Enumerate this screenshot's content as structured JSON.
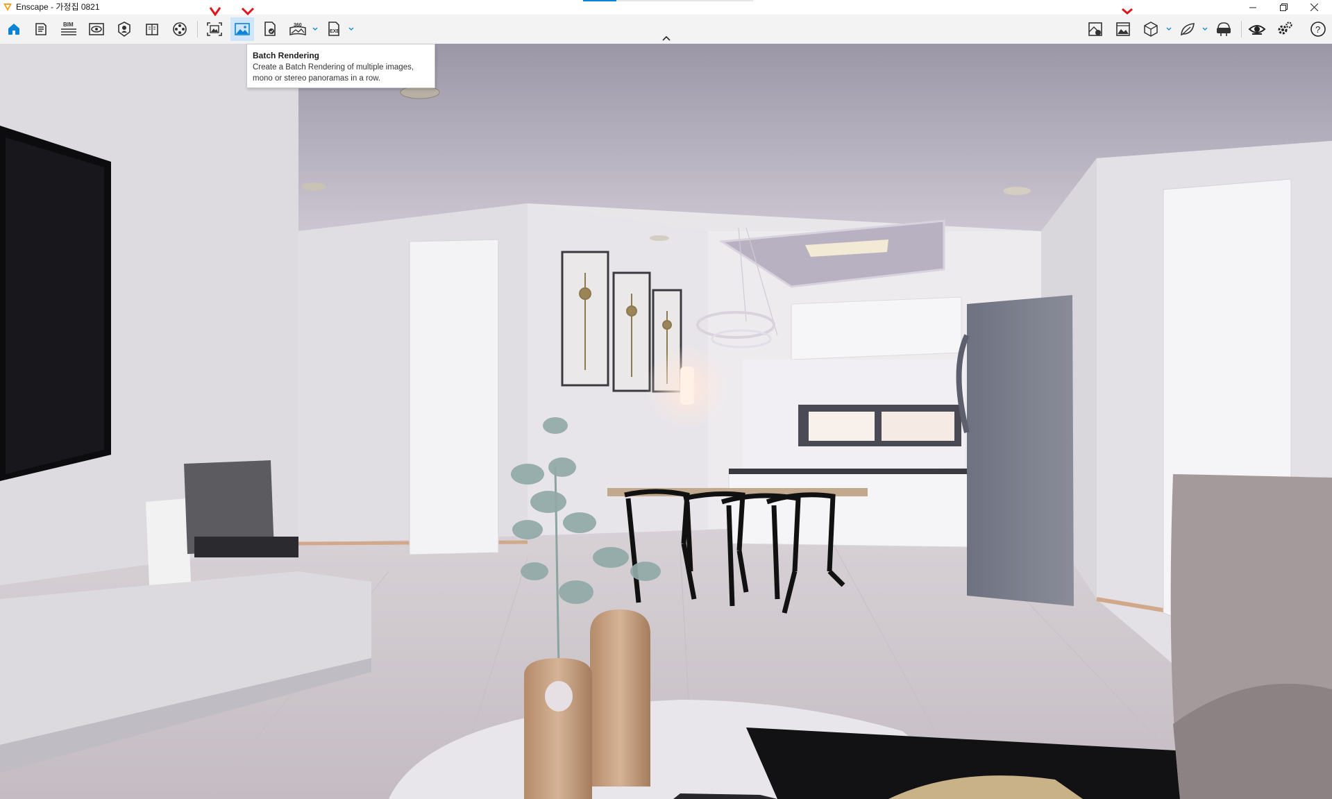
{
  "window": {
    "title": "Enscape - 가정집 0821",
    "controls": [
      "minimize",
      "restore",
      "close"
    ]
  },
  "toolbar": {
    "left_tools": [
      {
        "name": "home",
        "icon": "home-icon",
        "active": false
      },
      {
        "name": "project-info",
        "icon": "document-icon",
        "active": false
      },
      {
        "name": "bim",
        "icon": "bim-icon",
        "label": "BIM",
        "active": false
      },
      {
        "name": "views",
        "icon": "eye-icon",
        "active": false
      },
      {
        "name": "asset-library",
        "icon": "asset-library-icon",
        "active": false
      },
      {
        "name": "material-editor",
        "icon": "book-icon",
        "active": false
      },
      {
        "name": "video-editor",
        "icon": "film-reel-icon",
        "active": false
      },
      {
        "name": "screenshot",
        "icon": "screenshot-icon",
        "active": false
      },
      {
        "name": "batch-rendering",
        "icon": "image-icon",
        "active": true
      },
      {
        "name": "render-export",
        "icon": "render-doc-icon",
        "active": false
      },
      {
        "name": "panorama",
        "icon": "panorama-icon",
        "label": "360",
        "active": false,
        "dropdown": true
      },
      {
        "name": "exe-export",
        "icon": "exe-icon",
        "label": "EXE",
        "active": false,
        "dropdown": true
      }
    ],
    "right_tools": [
      {
        "name": "sketch-mode",
        "icon": "sketch-icon"
      },
      {
        "name": "render-gallery",
        "icon": "gallery-icon"
      },
      {
        "name": "view-mode",
        "icon": "cube-icon",
        "dropdown": true
      },
      {
        "name": "atmosphere",
        "icon": "leaf-icon",
        "dropdown": true
      },
      {
        "name": "vr-headset",
        "icon": "vr-headset-icon"
      },
      {
        "name": "visibility",
        "icon": "eye-icon"
      },
      {
        "name": "settings",
        "icon": "gear-icon"
      },
      {
        "name": "help",
        "icon": "help-icon"
      }
    ]
  },
  "tooltip": {
    "title": "Batch Rendering",
    "description": "Create a Batch Rendering of multiple images, mono or stereo panoramas in a row."
  },
  "colors": {
    "accent": "#0a84d6",
    "active_bg": "#cfe5fa",
    "annotation_red": "#e0141b",
    "toolbar_bg": "#f3f3f3",
    "logo": "#f7a21b"
  }
}
